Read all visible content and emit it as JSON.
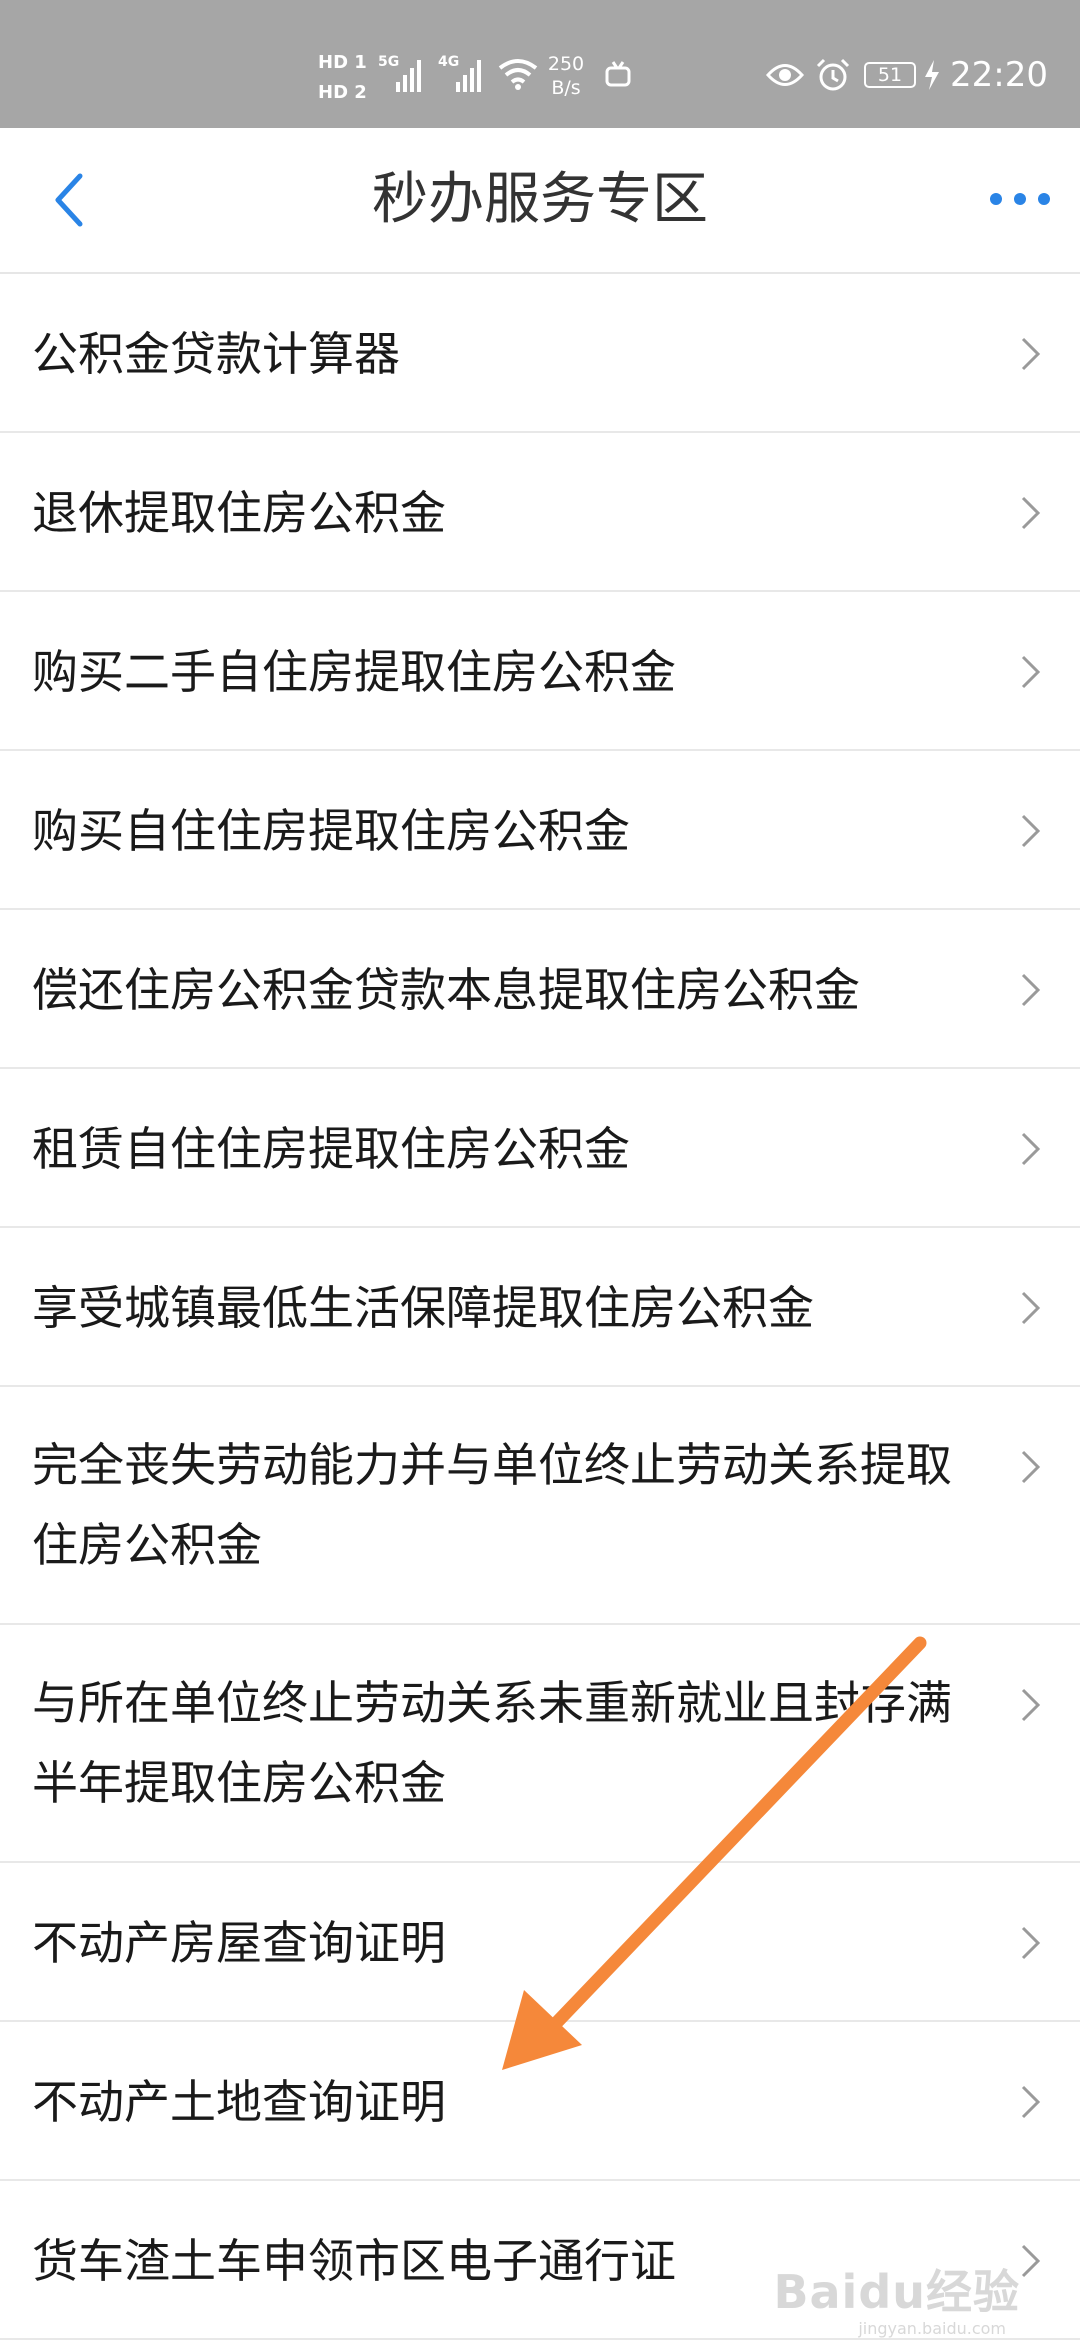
{
  "status_bar": {
    "hd1": "HD 1",
    "hd2": "HD 2",
    "network1": "5G",
    "network2": "4G",
    "speed_value": "250",
    "speed_unit": "B/s",
    "battery": "51",
    "time": "22:20"
  },
  "header": {
    "title": "秒办服务专区",
    "back_icon": "chevron-left-icon",
    "more_icon": "more-dots-icon",
    "accent_color": "#2a84e6"
  },
  "items": [
    {
      "label": "公积金贷款计算器"
    },
    {
      "label": "退休提取住房公积金"
    },
    {
      "label": "购买二手自住房提取住房公积金"
    },
    {
      "label": "购买自住住房提取住房公积金"
    },
    {
      "label": "偿还住房公积金贷款本息提取住房公积金"
    },
    {
      "label": "租赁自住住房提取住房公积金"
    },
    {
      "label": "享受城镇最低生活保障提取住房公积金"
    },
    {
      "label": "完全丧失劳动能力并与单位终止劳动关系提取住房公积金"
    },
    {
      "label": "与所在单位终止劳动关系未重新就业且封存满半年提取住房公积金"
    },
    {
      "label": "不动产房屋查询证明"
    },
    {
      "label": "不动产土地查询证明"
    },
    {
      "label": "货车渣土车申领市区电子通行证"
    }
  ],
  "annotation": {
    "arrow_color": "#f5883a"
  },
  "watermark": {
    "text": "Baidu经验",
    "sub": "jingyan.baidu.com"
  }
}
